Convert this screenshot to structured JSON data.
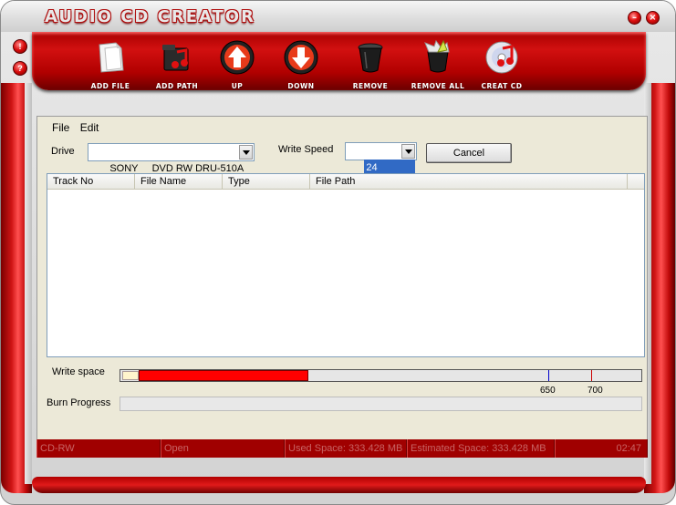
{
  "window": {
    "title": "AUDIO CD CREATOR",
    "minimize_symbol": "–",
    "close_symbol": "×"
  },
  "side_buttons": [
    {
      "symbol": "!",
      "icon": "alert-icon"
    },
    {
      "symbol": "?",
      "icon": "help-icon"
    }
  ],
  "toolbar": {
    "items": [
      {
        "label": "ADD FILE",
        "icon": "add-file-icon"
      },
      {
        "label": "ADD PATH",
        "icon": "add-path-icon"
      },
      {
        "label": "UP",
        "icon": "arrow-up-icon"
      },
      {
        "label": "DOWN",
        "icon": "arrow-down-icon"
      },
      {
        "label": "REMOVE",
        "icon": "trash-icon"
      },
      {
        "label": "REMOVE ALL",
        "icon": "trash-full-icon"
      },
      {
        "label": "CREAT CD",
        "icon": "cd-music-icon"
      }
    ]
  },
  "menu": {
    "file": "File",
    "edit": "Edit"
  },
  "drive": {
    "label": "Drive",
    "value": "SONY     DVD RW DRU-510A"
  },
  "write_speed": {
    "label": "Write Speed",
    "value": "24"
  },
  "cancel_label": "Cancel",
  "track_list": {
    "columns": [
      "Track No",
      "File Name",
      "Type",
      "File Path"
    ],
    "rows": []
  },
  "write_space": {
    "label": "Write space",
    "used_fraction": 0.36,
    "mark_650": "650",
    "mark_700": "700",
    "colors": {
      "used": "#ff0000",
      "mark_650": "#0000cc",
      "mark_700": "#cc0000"
    }
  },
  "burn_progress": {
    "label": "Burn Progress",
    "fraction": 0
  },
  "status_bar": {
    "media": "CD-RW",
    "state": "Open",
    "used_space": "Used Space: 333.428 MB",
    "estimated_space": "Estimated Space: 333.428 MB",
    "time": "02:47"
  },
  "theme": {
    "accent": "#c00000",
    "panel": "#ece9d8"
  }
}
